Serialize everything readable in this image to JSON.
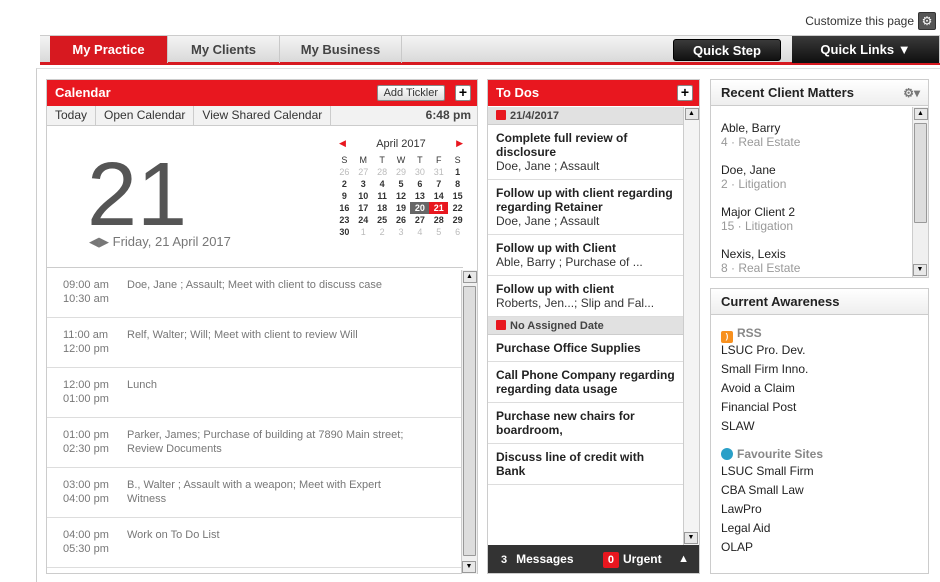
{
  "header": {
    "customize_label": "Customize this page"
  },
  "nav": {
    "tabs": [
      "My Practice",
      "My Clients",
      "My Business"
    ],
    "quick_step": "Quick Step",
    "quick_links": "Quick Links"
  },
  "calendar": {
    "title": "Calendar",
    "add_tickler": "Add Tickler",
    "toolbar": [
      "Today",
      "Open Calendar",
      "View Shared Calendar"
    ],
    "time": "6:48 pm",
    "big_day": "21",
    "day_label": "Friday, 21 April 2017",
    "mini": {
      "month": "April 2017",
      "weekdays": [
        "S",
        "M",
        "T",
        "W",
        "T",
        "F",
        "S"
      ],
      "weeks": [
        [
          "26",
          "27",
          "28",
          "29",
          "30",
          "31",
          "1"
        ],
        [
          "2",
          "3",
          "4",
          "5",
          "6",
          "7",
          "8"
        ],
        [
          "9",
          "10",
          "11",
          "12",
          "13",
          "14",
          "15"
        ],
        [
          "16",
          "17",
          "18",
          "19",
          "20",
          "21",
          "22"
        ],
        [
          "23",
          "24",
          "25",
          "26",
          "27",
          "28",
          "29"
        ],
        [
          "30",
          "1",
          "2",
          "3",
          "4",
          "5",
          "6"
        ]
      ]
    },
    "events": [
      {
        "start": "09:00 am",
        "end": "10:30 am",
        "desc": "Doe, Jane ; Assault; Meet with client to discuss case",
        "desc2": ""
      },
      {
        "start": "11:00 am",
        "end": "12:00 pm",
        "desc": "Relf, Walter; Will; Meet with client to review Will",
        "desc2": ""
      },
      {
        "start": "12:00 pm",
        "end": "01:00 pm",
        "desc": "Lunch",
        "desc2": ""
      },
      {
        "start": "01:00 pm",
        "end": "02:30 pm",
        "desc": "Parker, James; Purchase of building at 7890 Main street;",
        "desc2": "Review Documents"
      },
      {
        "start": "03:00 pm",
        "end": "04:00 pm",
        "desc": "B., Walter ; Assault with a weapon; Meet with Expert",
        "desc2": "Witness"
      },
      {
        "start": "04:00 pm",
        "end": "05:30 pm",
        "desc": "Work on To Do List",
        "desc2": ""
      }
    ]
  },
  "todos": {
    "title": "To Dos",
    "groups": [
      {
        "label": "21/4/2017",
        "items": [
          {
            "title": "Complete full review of disclosure",
            "sub": "Doe, Jane ; Assault"
          },
          {
            "title": "Follow up with client regarding regarding Retainer",
            "sub": "Doe, Jane ; Assault"
          },
          {
            "title": "Follow up with Client",
            "sub": "Able, Barry ; Purchase of ..."
          },
          {
            "title": "Follow up with client",
            "sub": "Roberts, Jen...; Slip and Fal..."
          }
        ]
      },
      {
        "label": "No Assigned Date",
        "items": [
          {
            "title": "Purchase Office Supplies",
            "sub": ""
          },
          {
            "title": "Call Phone Company regarding regarding data usage",
            "sub": ""
          },
          {
            "title": "Purchase new chairs for boardroom,",
            "sub": ""
          },
          {
            "title": "Discuss line of credit with Bank",
            "sub": ""
          }
        ]
      }
    ],
    "footer": {
      "messages_count": "3",
      "messages_label": "Messages",
      "urgent_count": "0",
      "urgent_label": "Urgent"
    }
  },
  "recent": {
    "title": "Recent Client Matters",
    "items": [
      {
        "name": "Able, Barry",
        "detail": "4 · Real Estate"
      },
      {
        "name": "Doe, Jane",
        "detail": "2 · Litigation"
      },
      {
        "name": "Major Client 2",
        "detail": "15 · Litigation"
      },
      {
        "name": "Nexis, Lexis",
        "detail": "8 · Real Estate"
      }
    ]
  },
  "awareness": {
    "title": "Current Awareness",
    "rss_label": "RSS",
    "rss_links": [
      "LSUC Pro. Dev.",
      "Small Firm Inno.",
      "Avoid a Claim",
      "Financial Post",
      "SLAW"
    ],
    "fav_label": "Favourite Sites",
    "fav_links": [
      "LSUC Small Firm",
      "CBA Small Law",
      "LawPro",
      "Legal Aid",
      "OLAP"
    ]
  }
}
